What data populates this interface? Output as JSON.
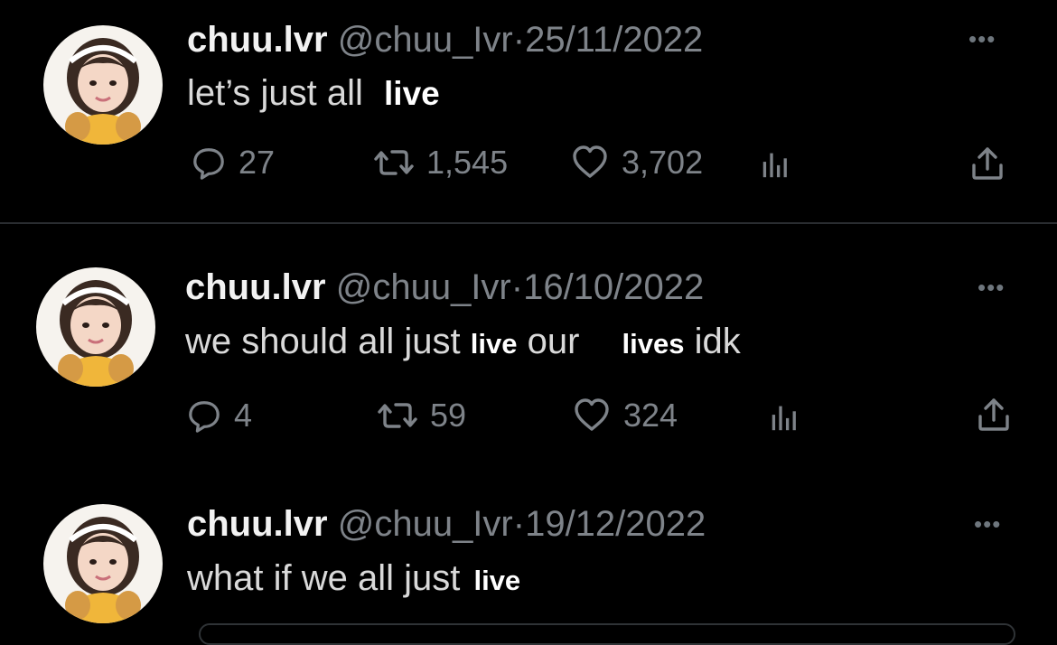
{
  "tweets": [
    {
      "display_name": "chuu.lvr",
      "handle": "@chuu_Ivr",
      "separator": "·",
      "date": "25/11/2022",
      "text_parts": [
        "let’s just all",
        "live"
      ],
      "replies": "27",
      "retweets": "1,545",
      "likes": "3,702"
    },
    {
      "display_name": "chuu.lvr",
      "handle": "@chuu_Ivr",
      "separator": "·",
      "date": "16/10/2022",
      "text_parts": [
        "we should all just",
        "live",
        "our",
        "lives",
        "idk"
      ],
      "replies": "4",
      "retweets": "59",
      "likes": "324"
    },
    {
      "display_name": "chuu.lvr",
      "handle": "@chuu_Ivr",
      "separator": "·",
      "date": "19/12/2022",
      "text_parts": [
        "what if we all just",
        "live"
      ]
    }
  ],
  "icons": {
    "more": "more-dots-icon",
    "reply": "reply-bubble-icon",
    "retweet": "retweet-arrows-icon",
    "like": "heart-icon",
    "views": "bar-chart-icon",
    "share": "share-upload-icon"
  },
  "colors": {
    "background": "#000000",
    "muted_text": "#7e8389",
    "primary_text": "#e7e9ea",
    "divider": "#2a2d31"
  }
}
